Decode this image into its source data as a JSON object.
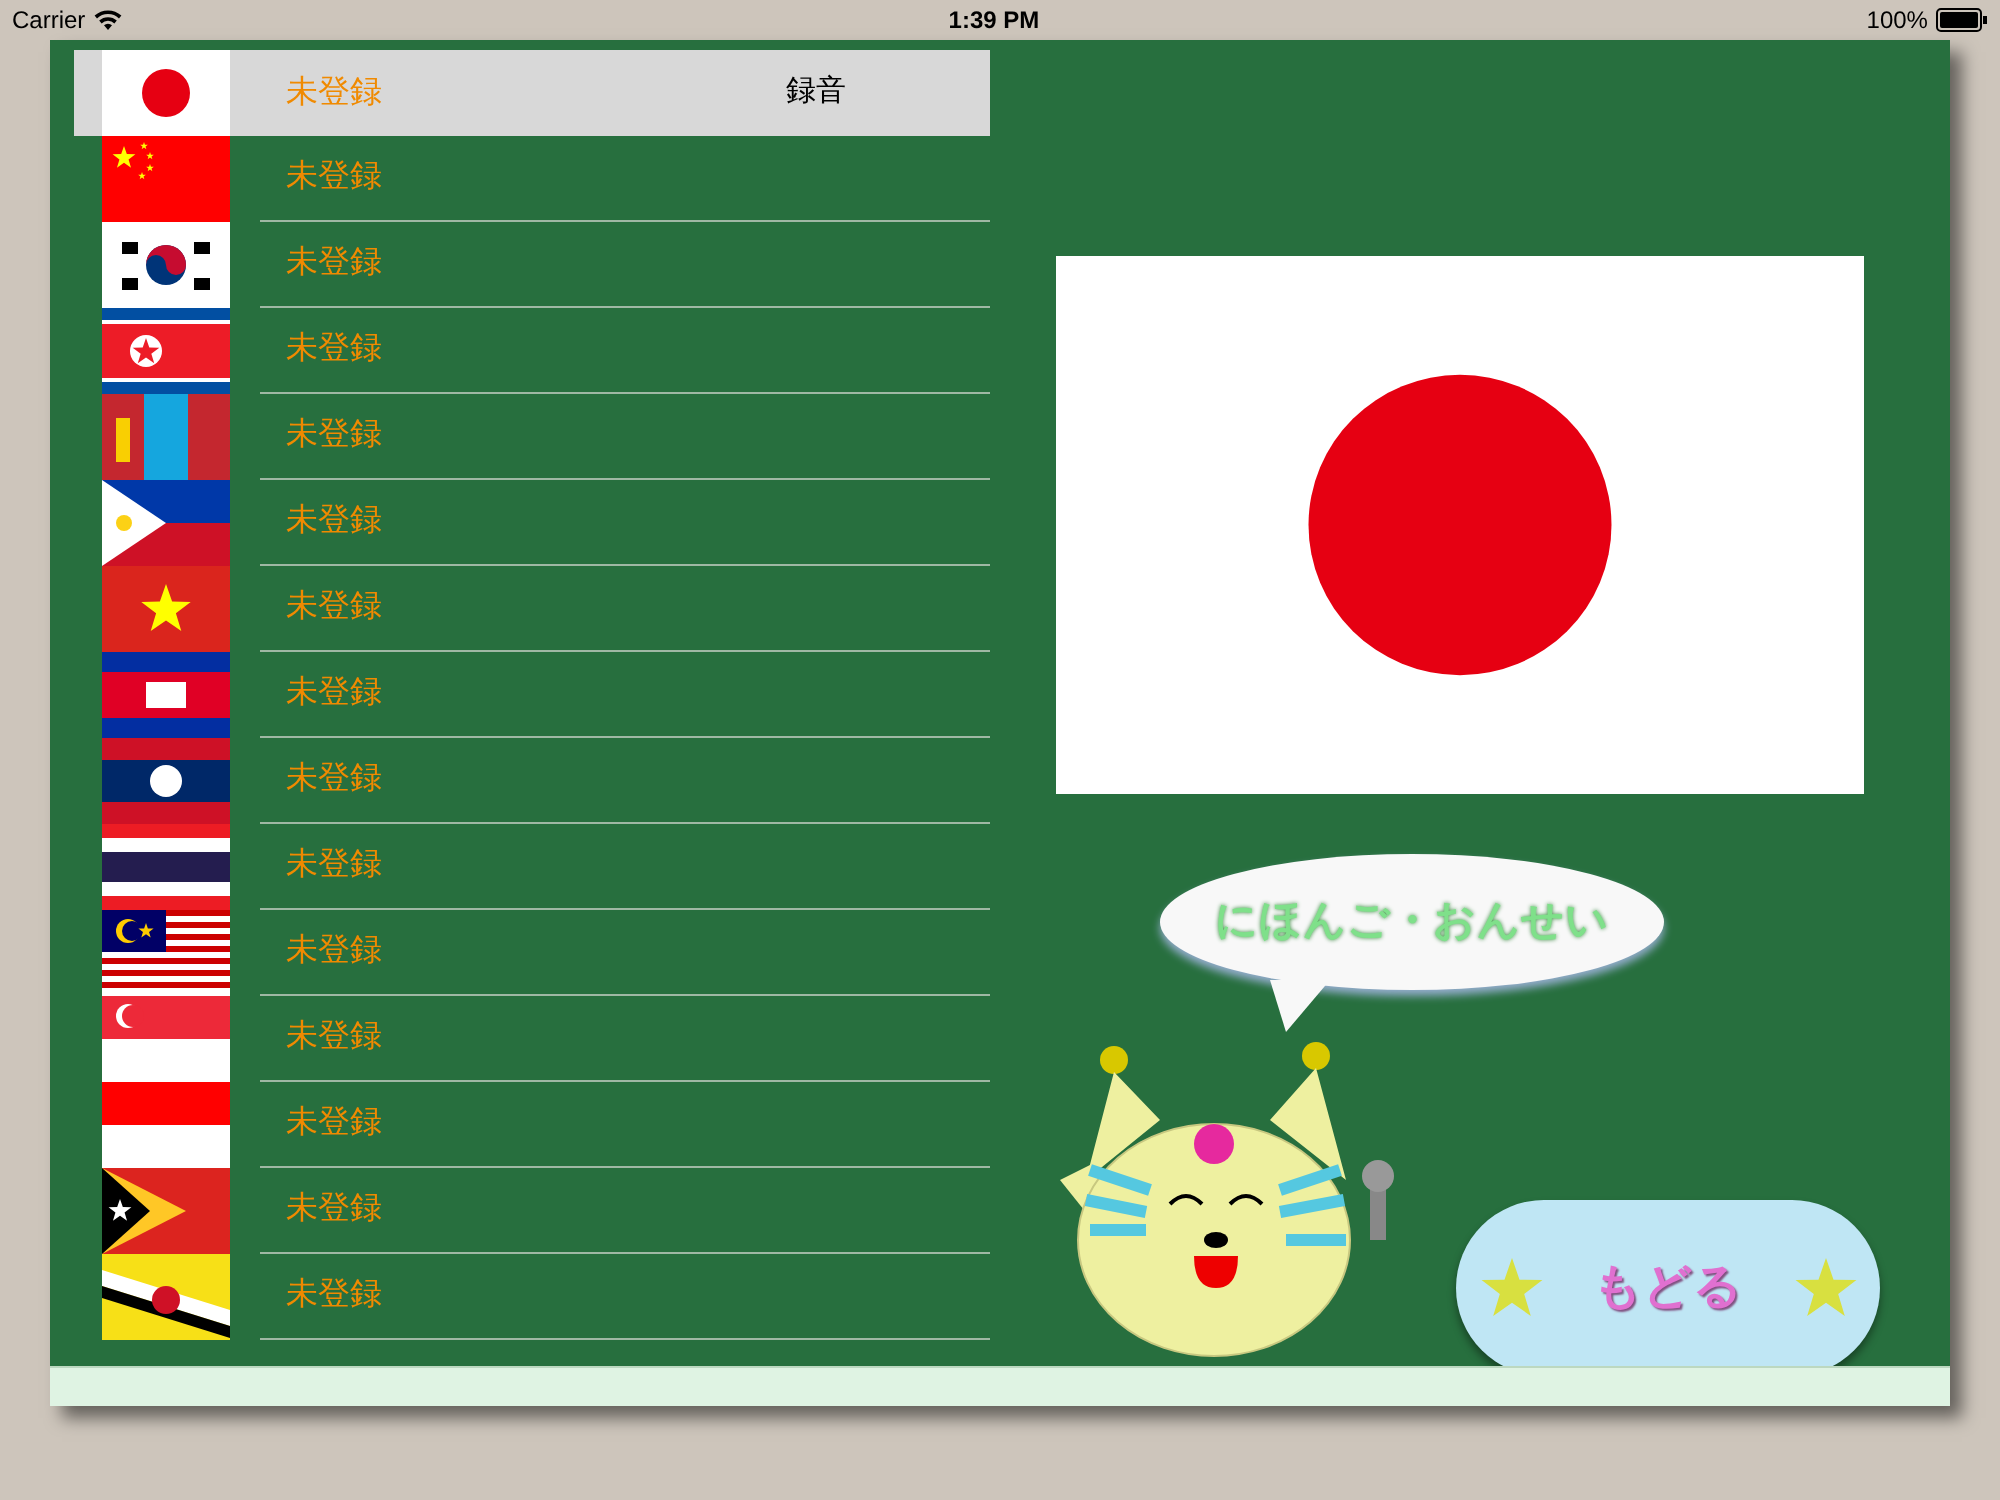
{
  "status_bar": {
    "carrier": "Carrier",
    "time": "1:39 PM",
    "battery": "100%"
  },
  "languages": [
    {
      "status": "未登録",
      "selected": true,
      "action": "録音"
    },
    {
      "status": "未登録",
      "selected": false
    },
    {
      "status": "未登録",
      "selected": false
    },
    {
      "status": "未登録",
      "selected": false
    },
    {
      "status": "未登録",
      "selected": false
    },
    {
      "status": "未登録",
      "selected": false
    },
    {
      "status": "未登録",
      "selected": false
    },
    {
      "status": "未登録",
      "selected": false
    },
    {
      "status": "未登録",
      "selected": false
    },
    {
      "status": "未登録",
      "selected": false
    },
    {
      "status": "未登録",
      "selected": false
    },
    {
      "status": "未登録",
      "selected": false
    },
    {
      "status": "未登録",
      "selected": false
    },
    {
      "status": "未登録",
      "selected": false
    },
    {
      "status": "未登録",
      "selected": false
    }
  ],
  "speech_bubble": "にほんご・おんせい",
  "back_button": "もどる"
}
